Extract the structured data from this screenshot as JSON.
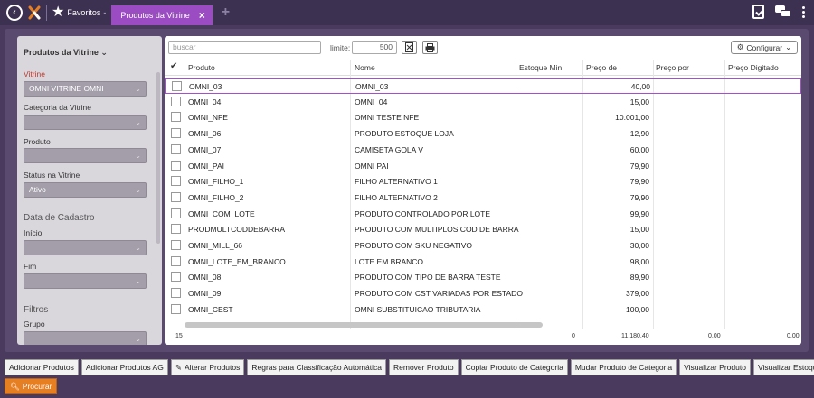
{
  "topbar": {
    "favoritos_label": "Favoritos",
    "tab_label": "Produtos da Vitrine",
    "tab_close": "×",
    "add_tab": "+"
  },
  "filters": {
    "title": "Produtos da Vitrine",
    "vitrine_label": "Vitrine",
    "vitrine_value": "OMNI VITRINE OMNI",
    "categoria_label": "Categoria da Vitrine",
    "categoria_value": "",
    "produto_label": "Produto",
    "produto_value": "",
    "status_label": "Status na Vitrine",
    "status_value": "Ativo",
    "data_section": "Data de Cadastro",
    "inicio_label": "Início",
    "inicio_value": "",
    "fim_label": "Fim",
    "fim_value": "",
    "filtros_section": "Filtros",
    "grupo_label": "Grupo",
    "grupo_value": ""
  },
  "toolbar": {
    "search_placeholder": "buscar",
    "limit_label": "limite:",
    "limit_value": "500",
    "configurar_label": "Configurar"
  },
  "table": {
    "columns": {
      "produto": "Produto",
      "nome": "Nome",
      "estoque_min": "Estoque Min",
      "preco_de": "Preço de",
      "preco_por": "Preço por",
      "preco_digitado": "Preço Digitado"
    },
    "rows": [
      {
        "produto": "OMNI_03",
        "nome": "OMNI_03",
        "preco_de": "40,00"
      },
      {
        "produto": "OMNI_04",
        "nome": "OMNI_04",
        "preco_de": "15,00"
      },
      {
        "produto": "OMNI_NFE",
        "nome": "OMNI TESTE NFE",
        "preco_de": "10.001,00"
      },
      {
        "produto": "OMNI_06",
        "nome": "PRODUTO ESTOQUE LOJA",
        "preco_de": "12,90"
      },
      {
        "produto": "OMNI_07",
        "nome": "CAMISETA GOLA V",
        "preco_de": "60,00"
      },
      {
        "produto": "OMNI_PAI",
        "nome": "OMNI PAI",
        "preco_de": "79,90"
      },
      {
        "produto": "OMNI_FILHO_1",
        "nome": "FILHO ALTERNATIVO 1",
        "preco_de": "79,90"
      },
      {
        "produto": "OMNI_FILHO_2",
        "nome": "FILHO ALTERNATIVO 2",
        "preco_de": "79,90"
      },
      {
        "produto": "OMNI_COM_LOTE",
        "nome": "PRODUTO CONTROLADO POR LOTE",
        "preco_de": "99,90"
      },
      {
        "produto": "PRODMULTCODDEBARRA",
        "nome": "PRODUTO COM MULTIPLOS COD DE BARRA",
        "preco_de": "15,00"
      },
      {
        "produto": "OMNI_MILL_66",
        "nome": "PRODUTO COM SKU NEGATIVO",
        "preco_de": "30,00"
      },
      {
        "produto": "OMNI_LOTE_EM_BRANCO",
        "nome": "LOTE EM BRANCO",
        "preco_de": "98,00"
      },
      {
        "produto": "OMNI_08",
        "nome": "PRODUTO COM TIPO DE BARRA TESTE",
        "preco_de": "89,90"
      },
      {
        "produto": "OMNI_09",
        "nome": "PRODUTO COM CST VARIADAS POR ESTADO",
        "preco_de": "379,00"
      },
      {
        "produto": "OMNI_CEST",
        "nome": "OMNI SUBSTITUICAO TRIBUTARIA",
        "preco_de": "100,00"
      }
    ],
    "footer": {
      "count": "15",
      "estoque_total": "0",
      "preco_de_total": "11.180,40",
      "preco_por_total": "0,00",
      "preco_digitado_total": "0,00"
    }
  },
  "actions": [
    "Adicionar Produtos",
    "Adicionar Produtos AG",
    "Alterar Produtos",
    "Regras para Classificação Automática",
    "Remover Produto",
    "Copiar Produto de Categoria",
    "Mudar Produto de Categoria",
    "Visualizar Produto",
    "Visualizar Estoque"
  ],
  "procurar_label": "Procurar",
  "colors": {
    "accent": "#9b4cc2",
    "topbar": "#3d3152",
    "procurar": "#e67e22",
    "required_label": "#c0392b"
  }
}
